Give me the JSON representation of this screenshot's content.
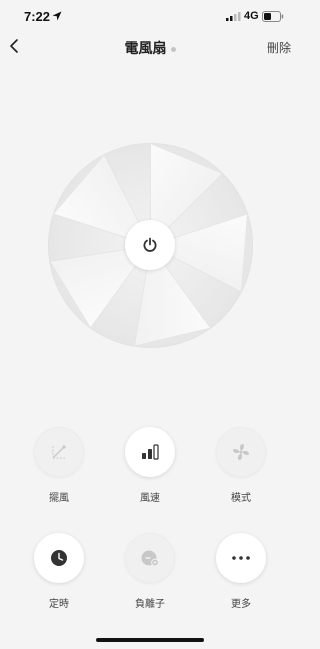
{
  "status_bar": {
    "time": "7:22",
    "network": "4G"
  },
  "nav": {
    "title": "電風扇",
    "delete_label": "刪除"
  },
  "controls": [
    {
      "label": "擺風",
      "icon": "oscillate-icon"
    },
    {
      "label": "風速",
      "icon": "fan-speed-icon"
    },
    {
      "label": "模式",
      "icon": "fan-mode-icon"
    },
    {
      "label": "定時",
      "icon": "timer-clock-icon"
    },
    {
      "label": "負離子",
      "icon": "anion-icon"
    },
    {
      "label": "更多",
      "icon": "more-icon"
    }
  ],
  "colors": {
    "background": "#f4f4f4",
    "icon_dark": "#333333",
    "icon_disabled": "#c8c8c8"
  }
}
